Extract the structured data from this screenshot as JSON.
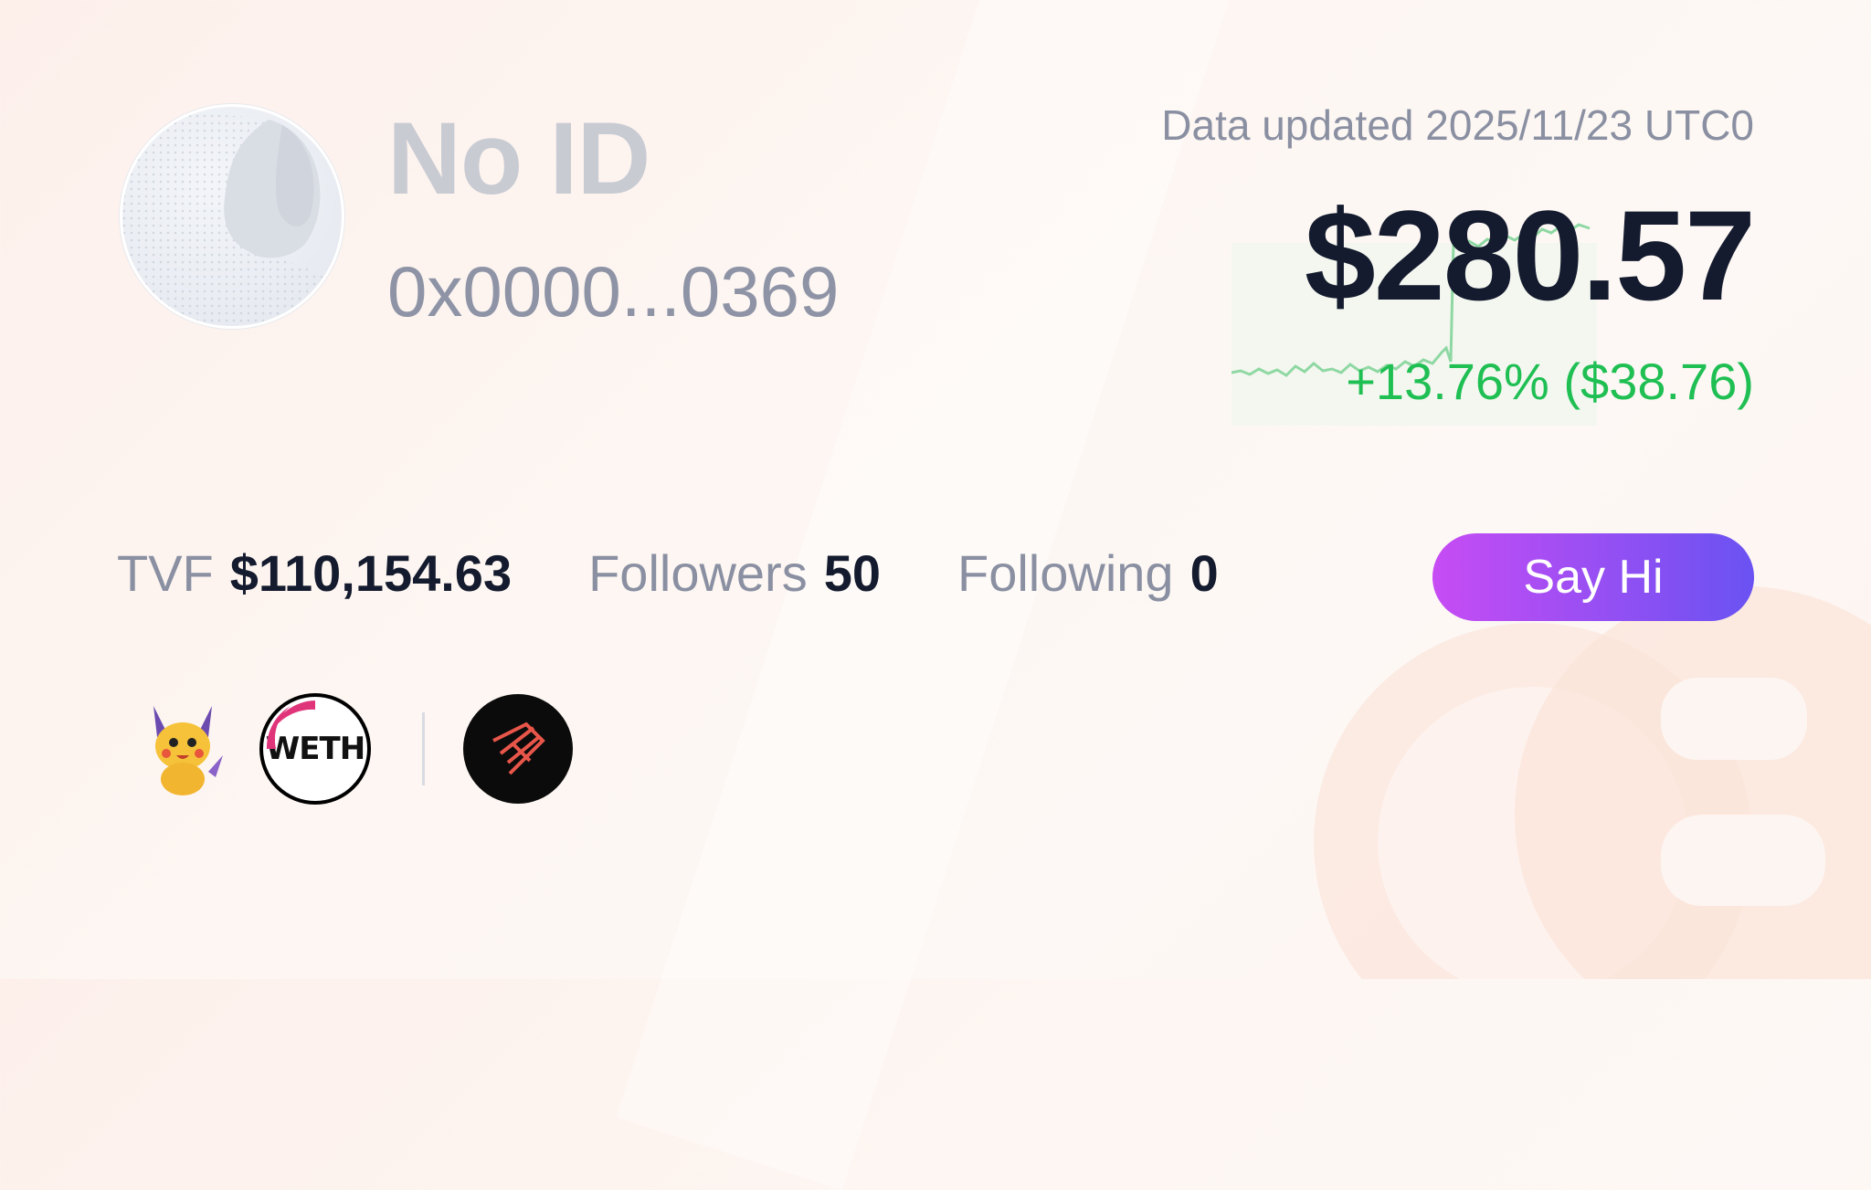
{
  "profile": {
    "name": "No ID",
    "address": "0x0000...0369"
  },
  "portfolio": {
    "updated": "Data updated 2025/11/23 UTC0",
    "value": "$280.57",
    "change": "+13.76% ($38.76)"
  },
  "stats": {
    "tvf_label": "TVF",
    "tvf_value": "$110,154.63",
    "followers_label": "Followers",
    "followers_value": "50",
    "following_label": "Following",
    "following_value": "0"
  },
  "actions": {
    "say_hi": "Say Hi"
  },
  "badges": {
    "weth_label": "WETH",
    "items": [
      "pikachu-token-icon",
      "weth-token-icon",
      "arrow-logo-icon"
    ]
  },
  "colors": {
    "accent_start": "#c74cf4",
    "accent_end": "#6a52f2",
    "positive": "#1fbf53",
    "primary_text": "#141b2e",
    "muted_text": "#8a90a2"
  }
}
